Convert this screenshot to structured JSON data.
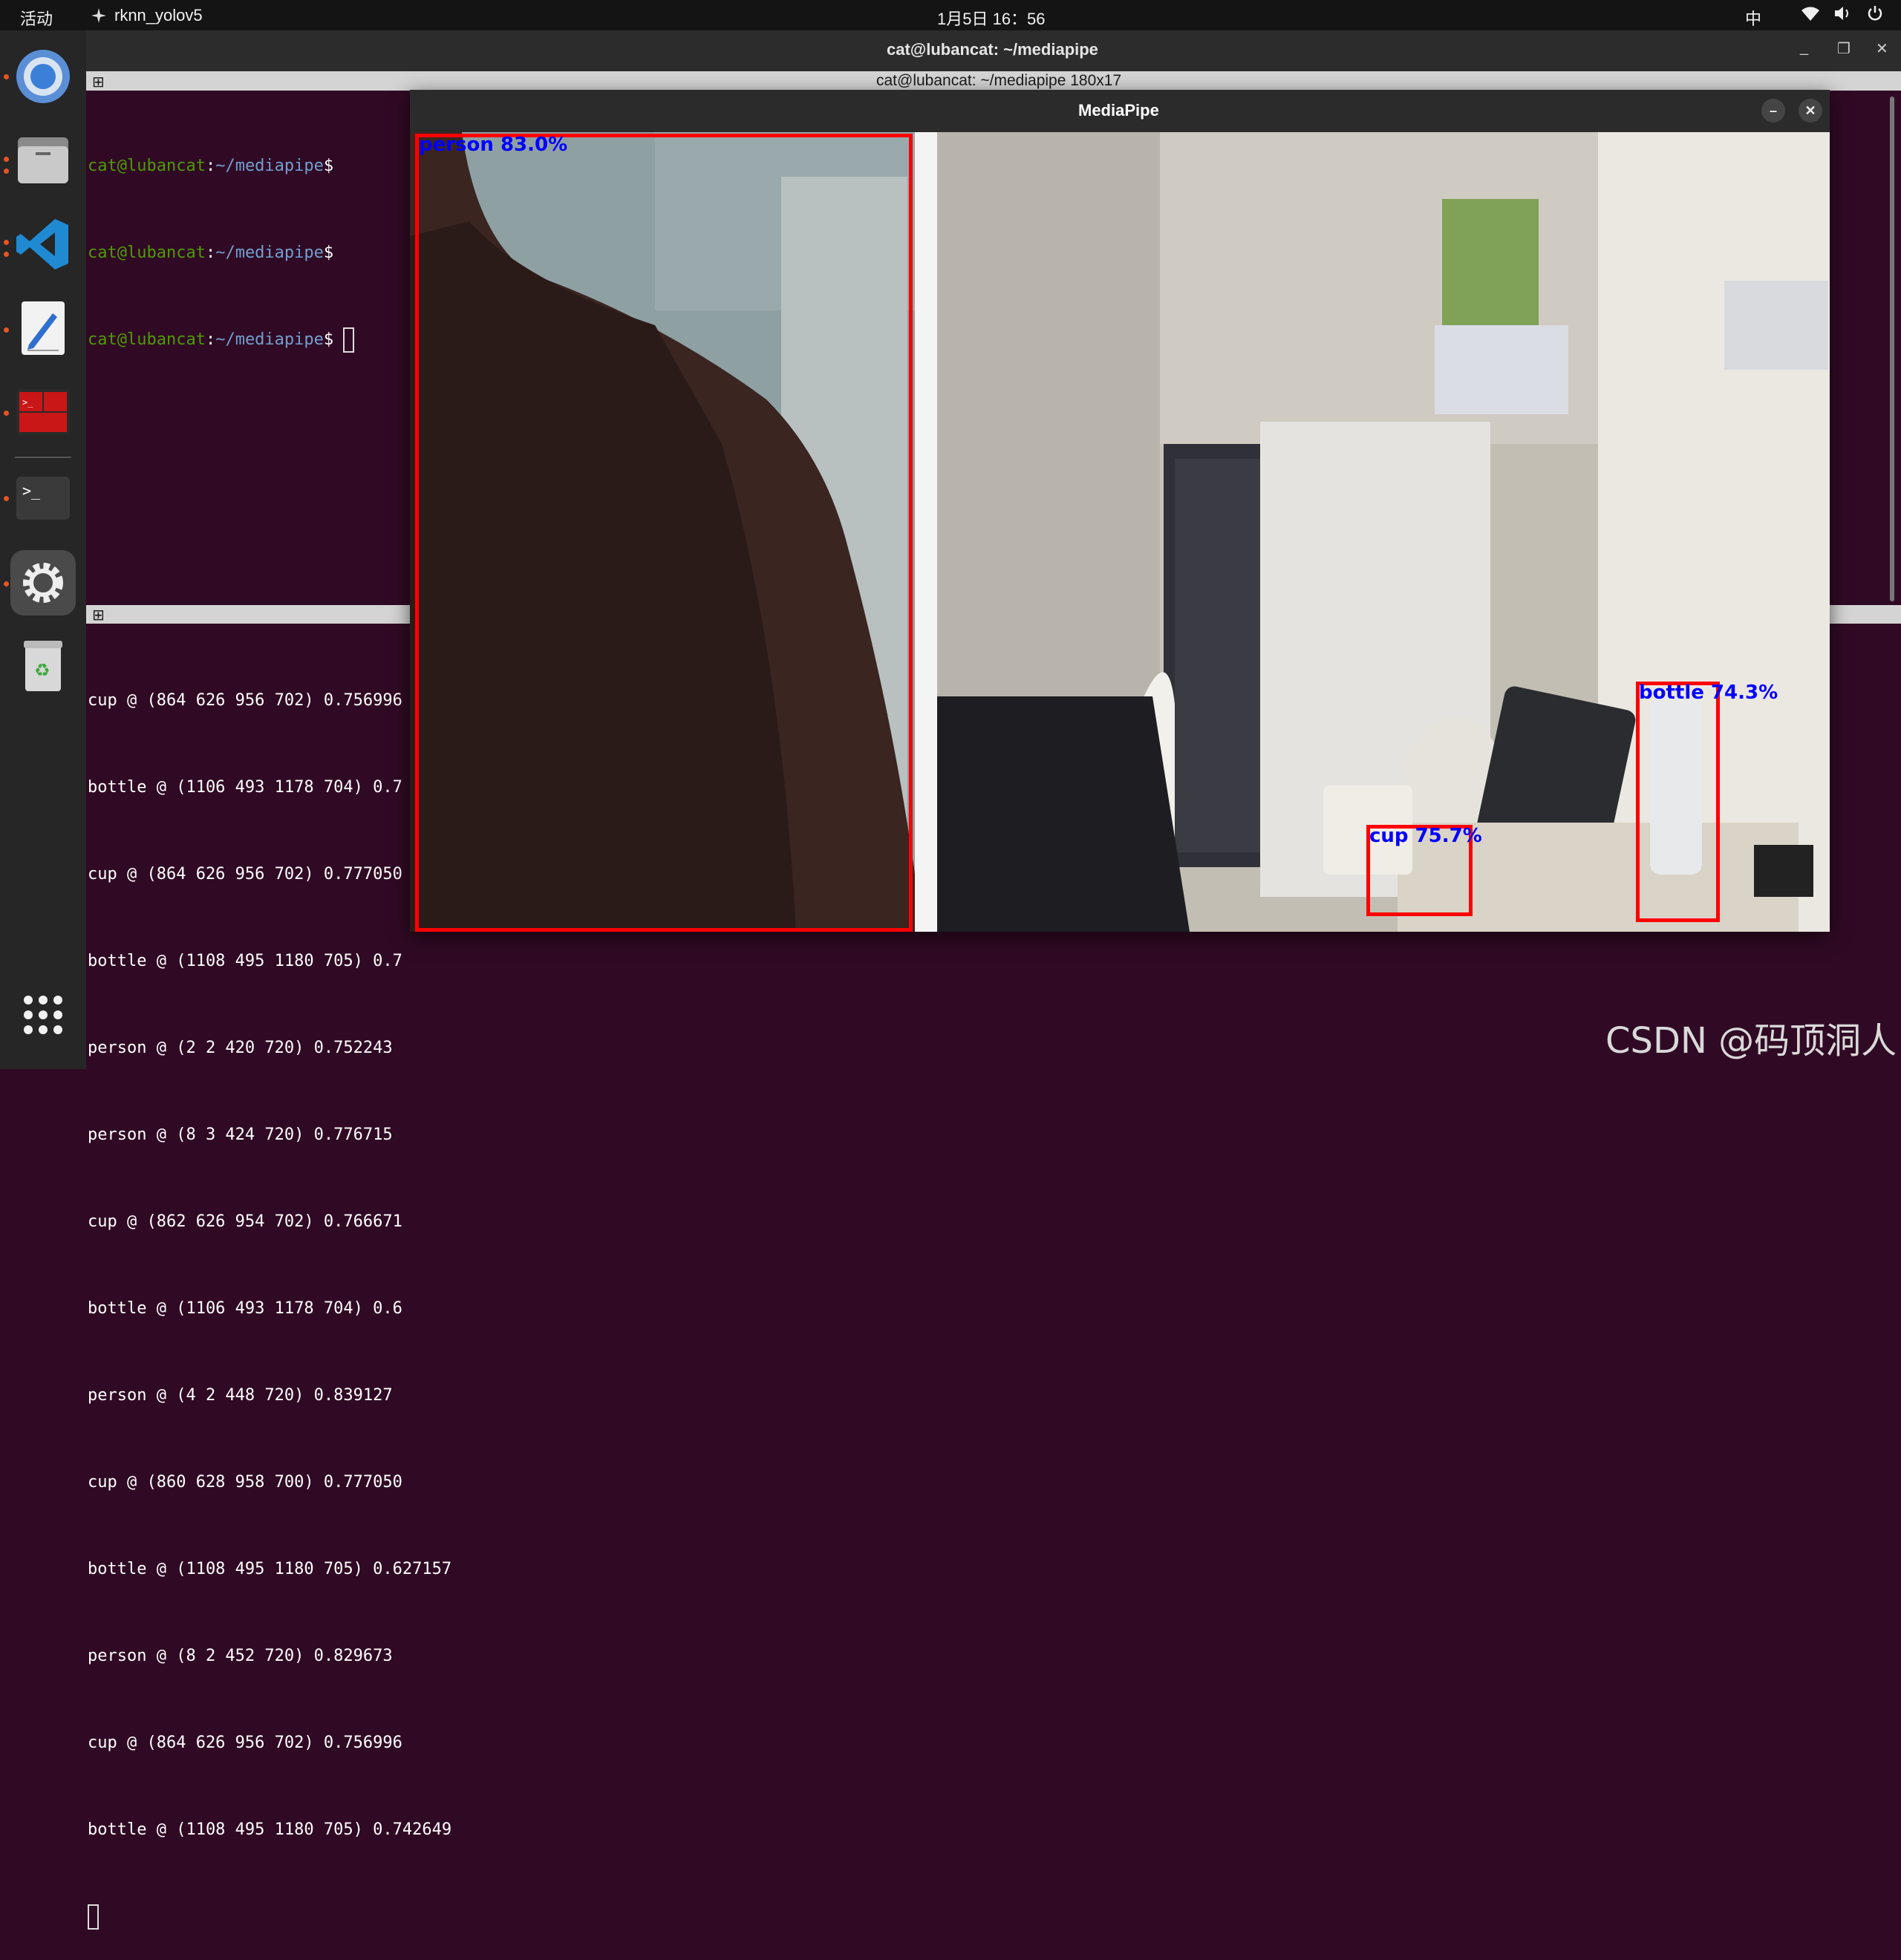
{
  "topbar": {
    "activities": "活动",
    "app_name": "rknn_yolov5",
    "clock": "1月5日 16：56",
    "ime": "中"
  },
  "dock": {
    "apps": [
      "chromium-icon",
      "files-icon",
      "vscode-icon",
      "text-editor-icon",
      "terminal-multiplexer-icon",
      "terminal-icon",
      "settings-icon",
      "trash-icon"
    ],
    "show_apps_icon": "app-grid-icon"
  },
  "terminal": {
    "window_title": "cat@lubancat: ~/mediapipe",
    "pane1_title": "cat@lubancat: ~/mediapipe 180x17",
    "prompt_user": "cat@lubancat",
    "prompt_sep": ":",
    "prompt_path": "~/mediapipe",
    "prompt_symbol": "$",
    "log_lines": [
      "cup @ (864 626 956 702) 0.756996",
      "bottle @ (1106 493 1178 704) 0.7",
      "cup @ (864 626 956 702) 0.777050",
      "bottle @ (1108 495 1180 705) 0.7",
      "person @ (2 2 420 720) 0.752243",
      "person @ (8 3 424 720) 0.776715",
      "cup @ (862 626 954 702) 0.766671",
      "bottle @ (1106 493 1178 704) 0.6",
      "person @ (4 2 448 720) 0.839127",
      "cup @ (860 628 958 700) 0.777050",
      "bottle @ (1108 495 1180 705) 0.627157",
      "person @ (8 2 452 720) 0.829673",
      "cup @ (864 626 956 702) 0.756996",
      "bottle @ (1108 495 1180 705) 0.742649"
    ]
  },
  "mediapipe": {
    "title": "MediaPipe",
    "detections": [
      {
        "label": "person 83.0%"
      },
      {
        "label": "cup 75.7%"
      },
      {
        "label": "bottle 74.3%"
      }
    ]
  },
  "watermark": "CSDN @码顶洞人",
  "colors": {
    "terminal_bg": "#300a24",
    "prompt_green": "#4e9a06",
    "prompt_blue": "#729fcf",
    "box_red": "#ff0000",
    "label_blue": "#0000ff",
    "accent_orange": "#e95420"
  }
}
